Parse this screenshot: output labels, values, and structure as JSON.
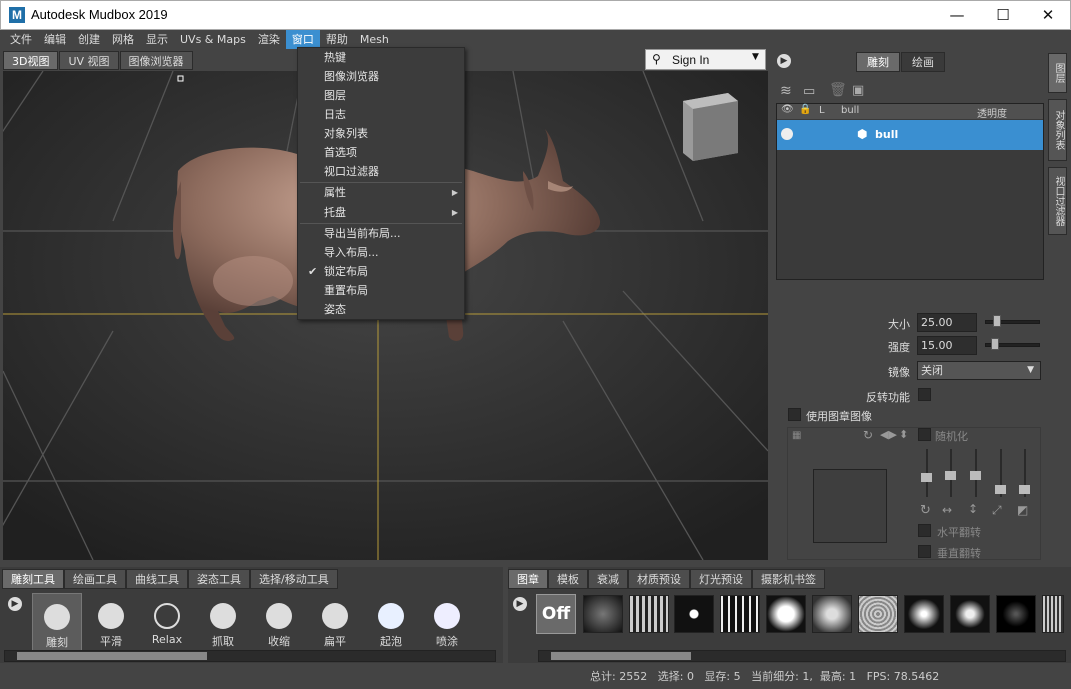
{
  "window": {
    "title": "Autodesk Mudbox 2019",
    "logo": "M",
    "min": "—",
    "max": "☐",
    "close": "✕"
  },
  "menubar": [
    "文件",
    "编辑",
    "创建",
    "网格",
    "显示",
    "UVs & Maps",
    "渲染",
    "窗口",
    "帮助",
    "Mesh"
  ],
  "viewport_tabs": [
    "3D视图",
    "UV 视图",
    "图像浏览器"
  ],
  "dropdown": {
    "items": [
      "热键",
      "图像浏览器",
      "图层",
      "日志",
      "对象列表",
      "首选项",
      "视口过滤器"
    ],
    "submenus": [
      "属性",
      "托盘"
    ],
    "layout_items": [
      "导出当前布局...",
      "导入布局...",
      "锁定布局",
      "重置布局",
      "姿态"
    ],
    "checked_item": "锁定布局"
  },
  "signin": {
    "label": "Sign In"
  },
  "right_panel": {
    "mode_tabs": [
      "雕刻",
      "绘画"
    ],
    "layers_header": {
      "name_col": "bull",
      "lock_col": "L",
      "opacity_col": "透明度"
    },
    "layer_row": {
      "name": "bull"
    },
    "props": {
      "size_label": "大小",
      "size_value": "25.00",
      "size_level": 0.18,
      "strength_label": "强度",
      "strength_value": "15.00",
      "strength_level": 0.12,
      "mirror_label": "镜像",
      "mirror_value": "关闭",
      "invert_label": "反转功能",
      "stamp_label": "使用图章图像",
      "random_label": "随机化",
      "hflip_label": "水平翻转",
      "vflip_label": "垂直翻转"
    }
  },
  "vertical_tabs": [
    "图层",
    "对象列表",
    "视口过滤器"
  ],
  "bottom_left": {
    "tabs": [
      "雕刻工具",
      "绘画工具",
      "曲线工具",
      "姿态工具",
      "选择/移动工具"
    ],
    "tools": [
      "雕刻",
      "平滑",
      "Relax",
      "抓取",
      "收缩",
      "扁平",
      "起泡",
      "喷涂"
    ]
  },
  "bottom_right": {
    "tabs": [
      "图章",
      "模板",
      "衰减",
      "材质预设",
      "灯光预设",
      "摄影机书签"
    ],
    "off_label": "Off"
  },
  "status": {
    "total_label": "总计:",
    "total": "2552",
    "select_label": "选择:",
    "select": "0",
    "display_label": "显存:",
    "display": "5",
    "subdiv_label": "当前细分:",
    "subdiv": "1,",
    "max_label": "最高:",
    "max": "1",
    "fps_label": "FPS:",
    "fps": "78.5462"
  },
  "colors": {
    "accent": "#3b8fd0",
    "bull": "#8b6a5e",
    "guide": "#b59a3a"
  }
}
